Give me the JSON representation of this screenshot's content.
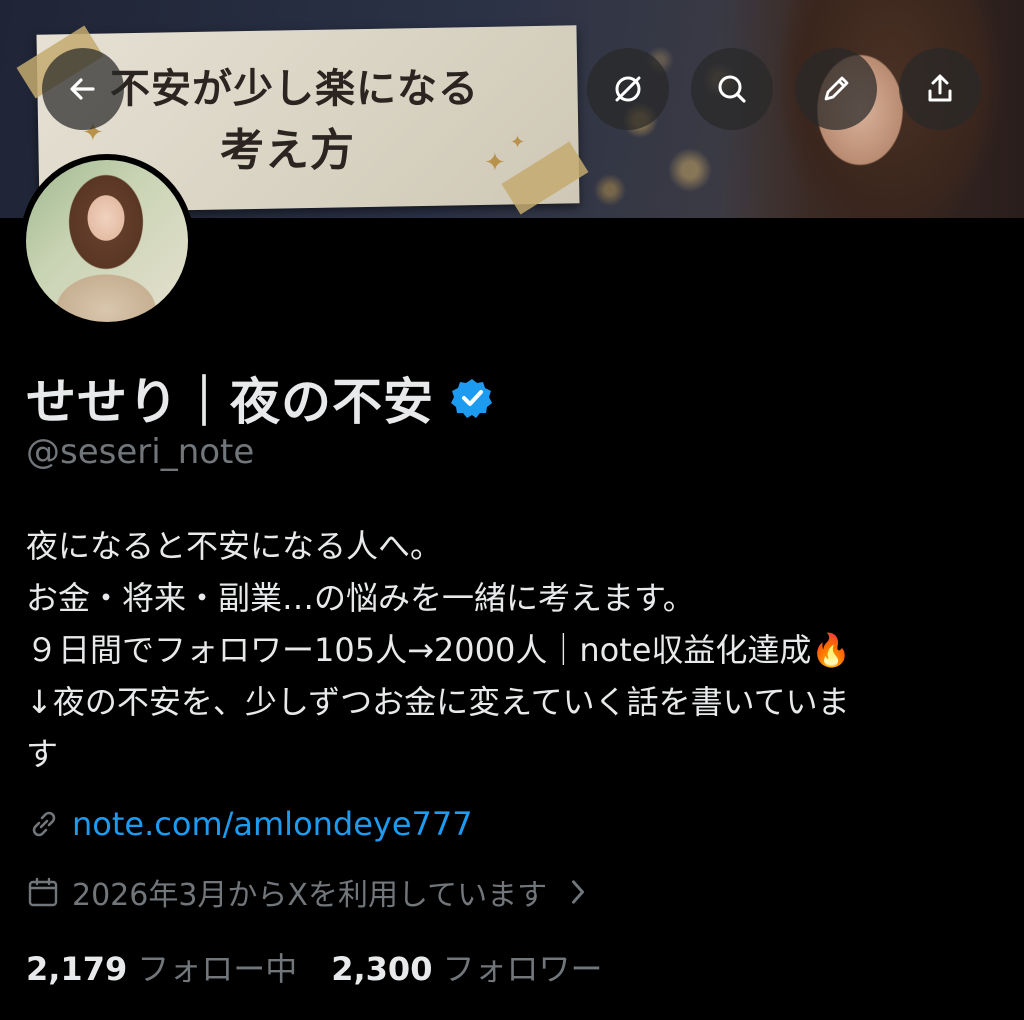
{
  "banner": {
    "title_line1": "不安が少し楽になる",
    "title_line2": "考え方"
  },
  "toolbar": {
    "icons": [
      "back-arrow-icon",
      "grok-icon",
      "search-icon",
      "pencil-icon",
      "share-icon"
    ]
  },
  "profile": {
    "display_name": "せせり｜夜の不安",
    "handle": "@seseri_note",
    "verified": true,
    "bio_lines": [
      "夜になると不安になる人へ。",
      "お金・将来・副業…の悩みを一緒に考えます。",
      "９日間でフォロワー105人→2000人｜note収益化達成🔥",
      "↓夜の不安を、少しずつお金に変えていく話を書いていま",
      "す"
    ],
    "link": "note.com/amlondeye777",
    "joined": "2026年3月からXを利用しています"
  },
  "stats": {
    "following_count": "2,179",
    "following_label": "フォロー中",
    "followers_count": "2,300",
    "followers_label": "フォロワー"
  },
  "colors": {
    "background": "#000000",
    "text": "#e7e9ea",
    "muted": "#71767b",
    "link": "#1d9bf0",
    "verified": "#1d9bf0"
  }
}
